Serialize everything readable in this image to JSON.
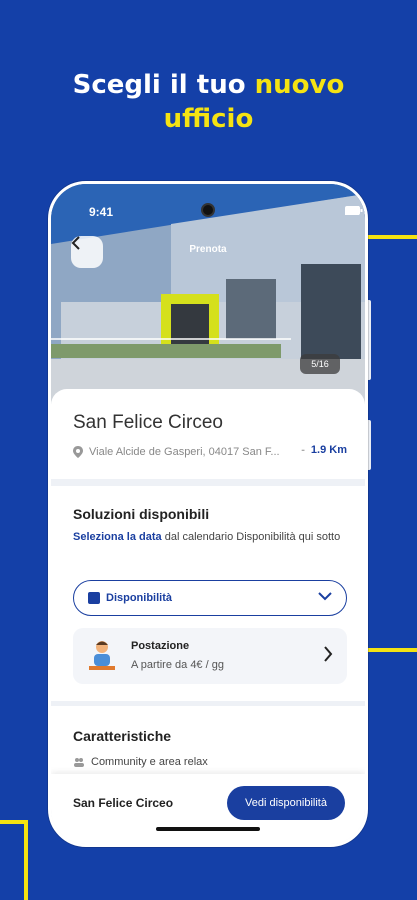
{
  "headline": {
    "line1": "Scegli il tuo ",
    "accent1": "nuovo",
    "accent2": "ufficio"
  },
  "status": {
    "time": "9:41"
  },
  "header": {
    "title": "Prenota",
    "photo_counter": "5/16"
  },
  "venue": {
    "name": "San Felice Circeo",
    "address": "Viale Alcide de Gasperi, 04017 San F...",
    "separator": "-",
    "distance": "1.9 Km"
  },
  "solutions": {
    "title": "Soluzioni disponibili",
    "desc_link": "Seleziona la data",
    "desc_rest": " dal calendario Disponibilità qui sotto",
    "availability_label": "Disponibilità",
    "item": {
      "title": "Postazione",
      "price": "A partire da 4€ / gg"
    }
  },
  "features": {
    "title": "Caratteristiche",
    "items": [
      "Community e area relax"
    ]
  },
  "bottom": {
    "name": "San Felice Circeo",
    "cta": "Vedi disponibilità"
  },
  "colors": {
    "brand": "#1a3fa0",
    "accent": "#f5e312",
    "background": "#1440a8"
  }
}
